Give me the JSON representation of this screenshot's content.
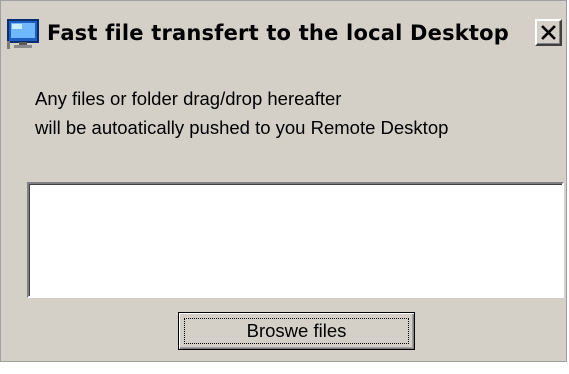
{
  "window": {
    "title": "Fast file transfert to the local Desktop",
    "app_icon": "monitor-icon",
    "close_icon": "close-icon",
    "background_color": "#d4d0c8"
  },
  "content": {
    "description_lines": [
      "Any files or folder drag/drop hereafter",
      "will be autoatically pushed to you Remote Desktop"
    ],
    "drop_area_value": ""
  },
  "actions": {
    "browse_label": "Broswe files"
  }
}
